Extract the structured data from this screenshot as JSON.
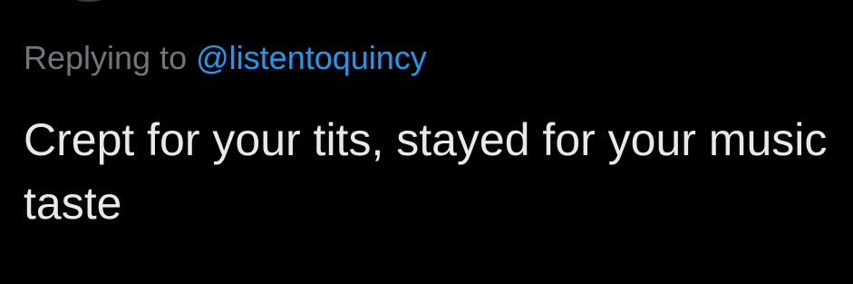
{
  "tweet": {
    "reply_prefix": "Replying to",
    "reply_handle": "@listentoquincy",
    "text": "Crept for your tits, stayed for your music taste"
  },
  "colors": {
    "background": "#000000",
    "secondary_text": "#71767b",
    "link": "#1d9bf0",
    "primary_text": "#e7e9ea"
  }
}
